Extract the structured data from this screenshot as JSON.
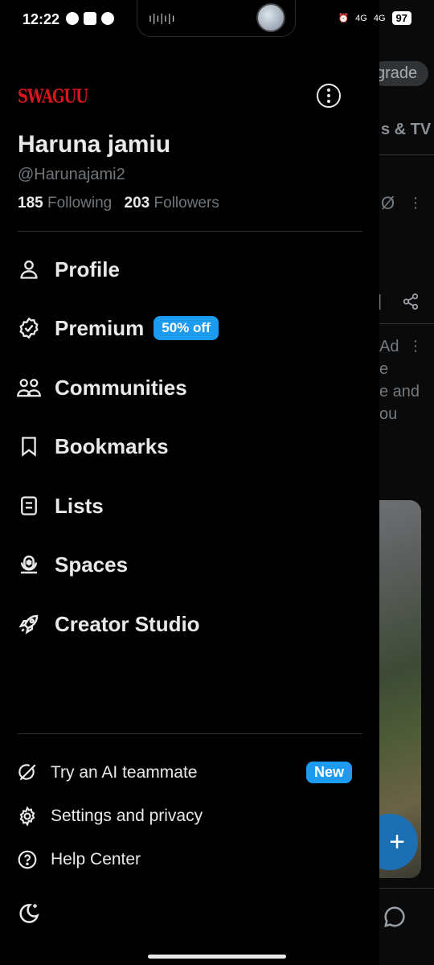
{
  "status_bar": {
    "time": "12:22",
    "network_1": "4G",
    "network_2": "4G",
    "battery": "97"
  },
  "profile": {
    "logo_text": "SWAGUU",
    "name": "Haruna jamiu",
    "handle": "@Harunajami2",
    "following_count": "185",
    "following_label": "Following",
    "followers_count": "203",
    "followers_label": "Followers"
  },
  "menu": {
    "items": [
      {
        "label": "Profile",
        "icon": "person-icon"
      },
      {
        "label": "Premium",
        "icon": "verified-badge-icon",
        "badge": "50% off"
      },
      {
        "label": "Communities",
        "icon": "people-icon"
      },
      {
        "label": "Bookmarks",
        "icon": "bookmark-icon"
      },
      {
        "label": "Lists",
        "icon": "list-icon"
      },
      {
        "label": "Spaces",
        "icon": "spaces-icon"
      },
      {
        "label": "Creator Studio",
        "icon": "rocket-icon"
      }
    ]
  },
  "secondary": {
    "items": [
      {
        "label": "Try an AI teammate",
        "icon": "grok-icon",
        "badge": "New"
      },
      {
        "label": "Settings and privacy",
        "icon": "gear-icon"
      },
      {
        "label": "Help Center",
        "icon": "help-icon"
      }
    ]
  },
  "background": {
    "upgrade_fragment": "grade",
    "tab_fragment": "s & TV",
    "ad_fragment": "Ad",
    "text_fragment_1": "e",
    "text_fragment_2": "e and",
    "text_fragment_3": "ou"
  }
}
